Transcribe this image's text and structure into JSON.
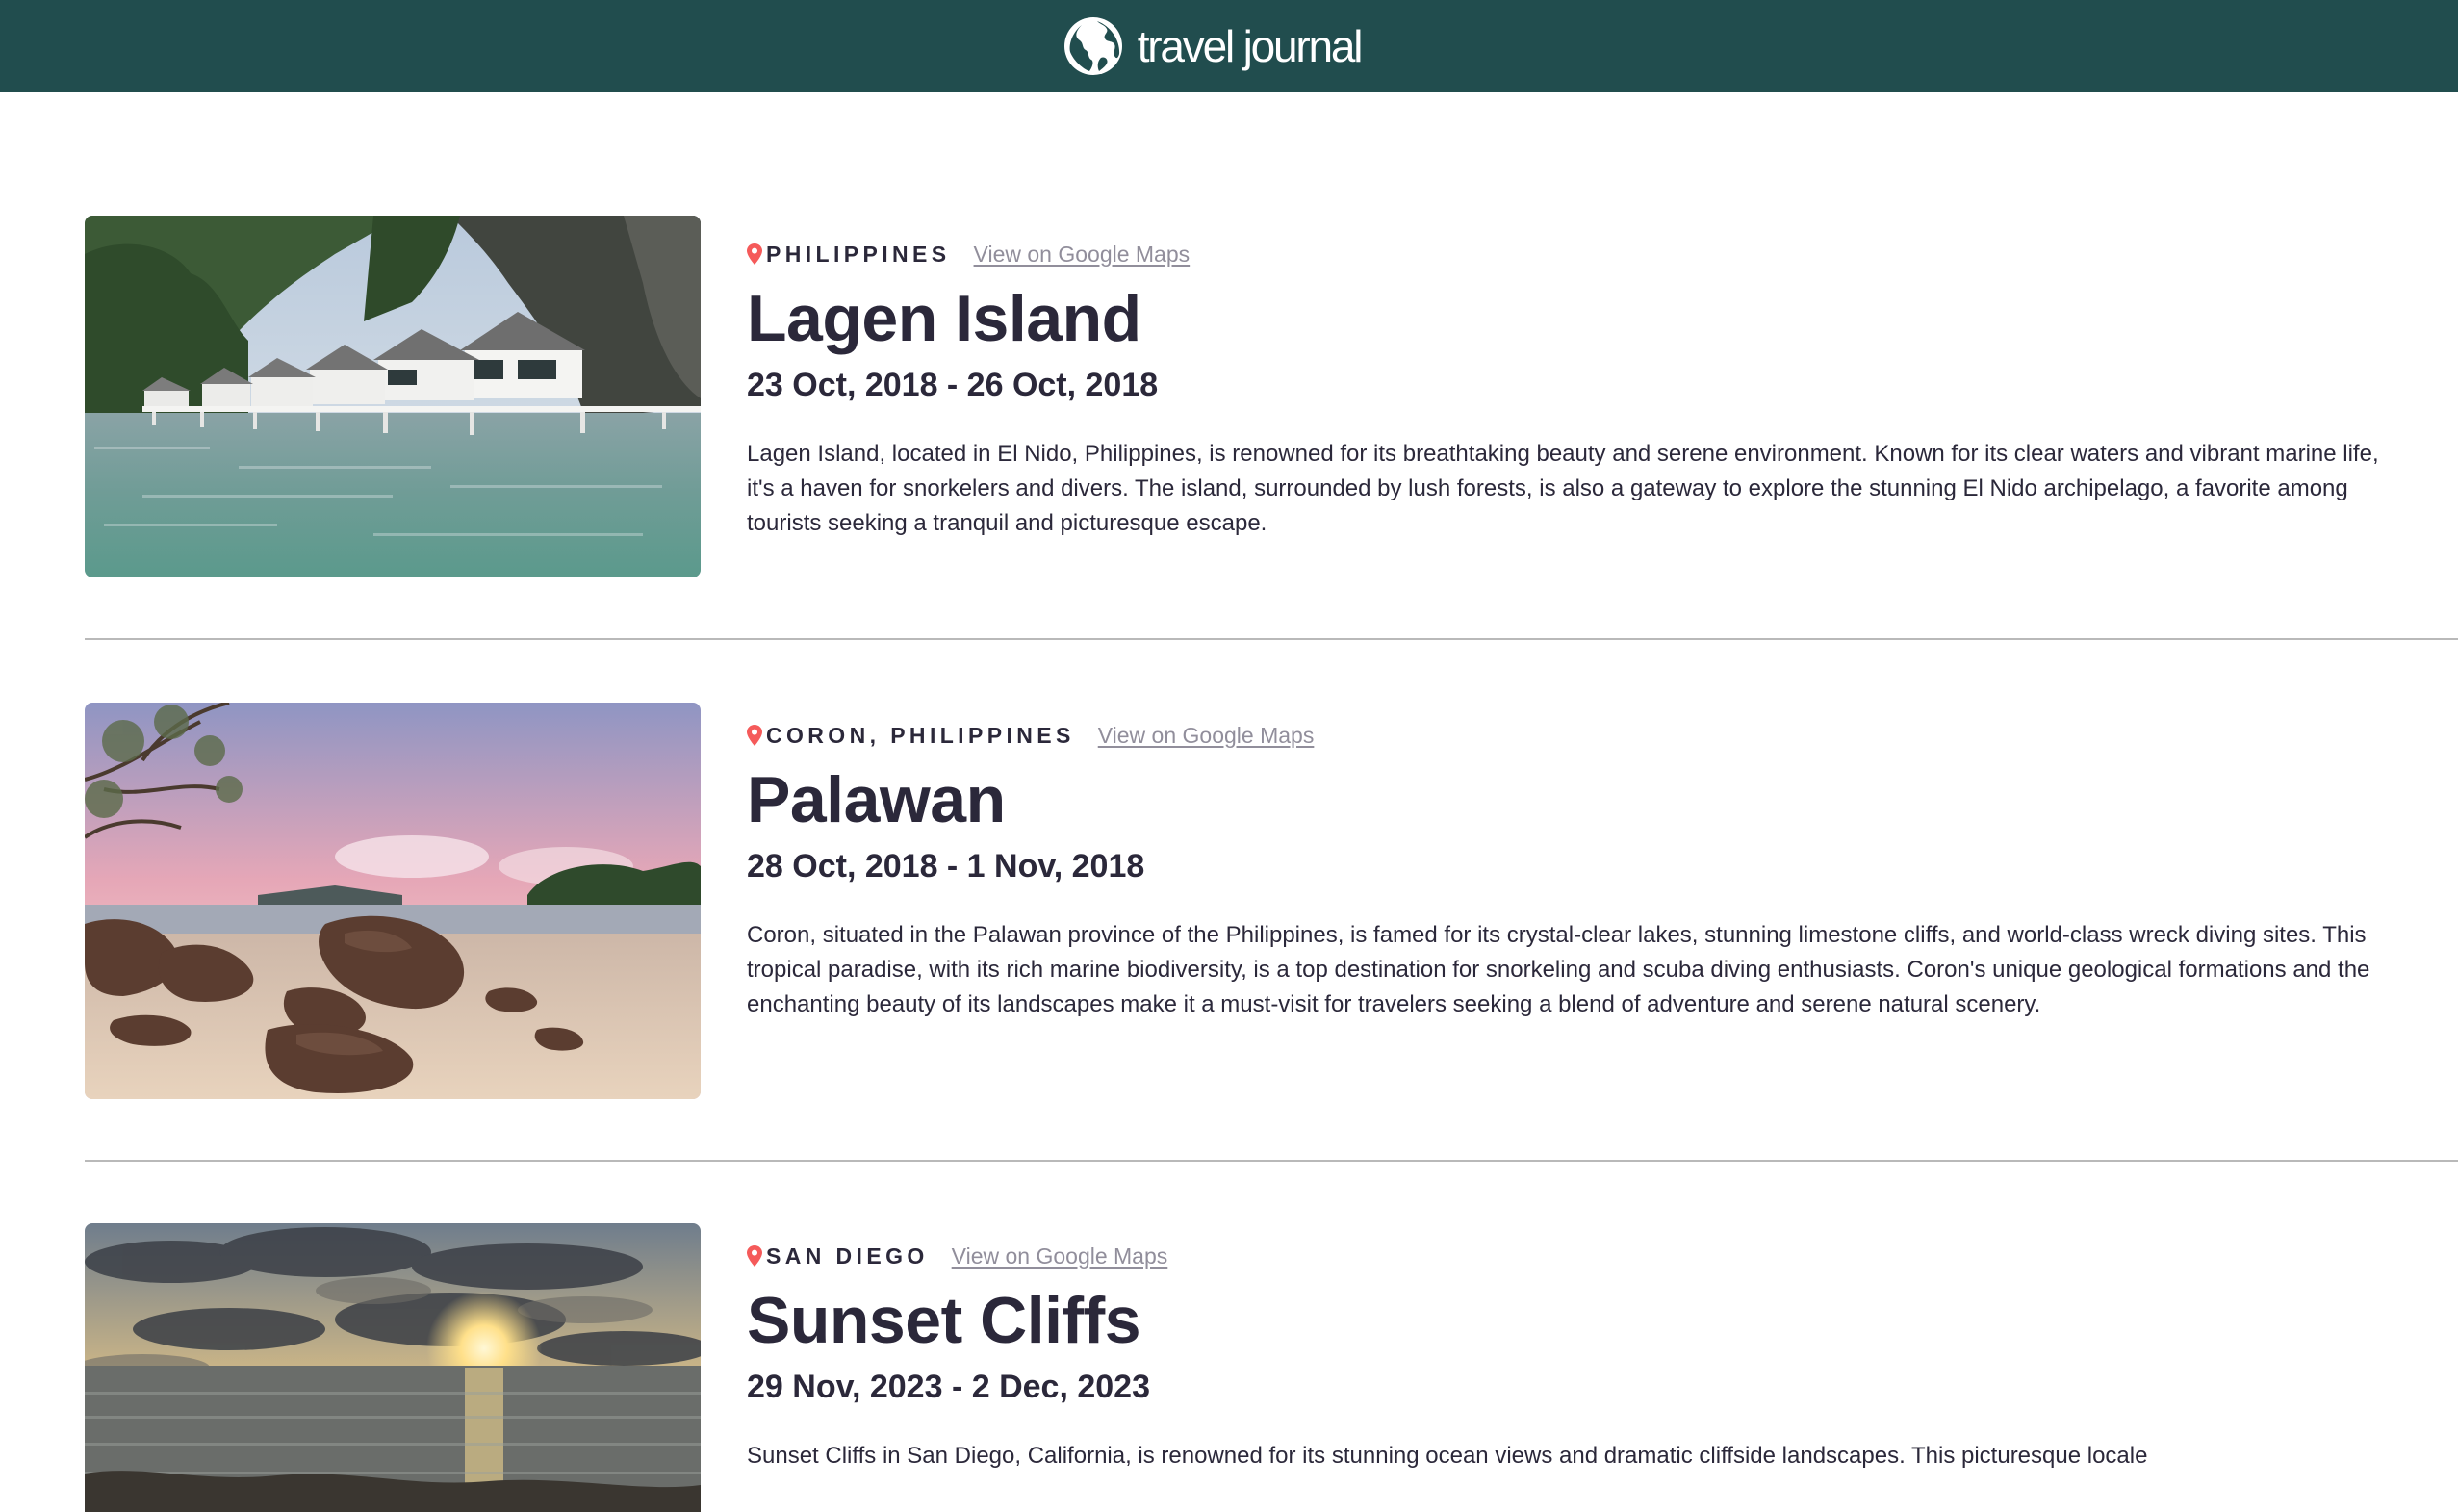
{
  "header": {
    "brand_name": "travel journal",
    "logo_icon": "globe-icon",
    "background": "#214d4e"
  },
  "colors": {
    "pin": "#f55a5a",
    "text": "#2b283a",
    "link": "#918e9b"
  },
  "entries": [
    {
      "location": "PHILIPPINES",
      "maps_label": "View on Google Maps",
      "title": "Lagen Island",
      "dates": "23 Oct, 2018 - 26 Oct, 2018",
      "description": "Lagen Island, located in El Nido, Philippines, is renowned for its breathtaking beauty and serene environment. Known for its clear waters and vibrant marine life, it's a haven for snorkelers and divers. The island, surrounded by lush forests, is also a gateway to explore the stunning El Nido archipelago, a favorite among tourists seeking a tranquil and picturesque escape.",
      "photo": "overwater-bungalows-photo"
    },
    {
      "location": "CORON, PHILIPPINES",
      "maps_label": "View on Google Maps",
      "title": "Palawan",
      "dates": "28 Oct, 2018 - 1 Nov, 2018",
      "description": "Coron, situated in the Palawan province of the Philippines, is famed for its crystal-clear lakes, stunning limestone cliffs, and world-class wreck diving sites. This tropical paradise, with its rich marine biodiversity, is a top destination for snorkeling and scuba diving enthusiasts. Coron's unique geological formations and the enchanting beauty of its landscapes make it a must-visit for travelers seeking a blend of adventure and serene natural scenery.",
      "photo": "rocky-beach-sunset-photo"
    },
    {
      "location": "SAN DIEGO",
      "maps_label": "View on Google Maps",
      "title": "Sunset Cliffs",
      "dates": "29 Nov, 2023 - 2 Dec, 2023",
      "description": "Sunset Cliffs in San Diego, California, is renowned for its stunning ocean views and dramatic cliffside landscapes. This picturesque locale",
      "photo": "ocean-sunset-photo"
    }
  ]
}
